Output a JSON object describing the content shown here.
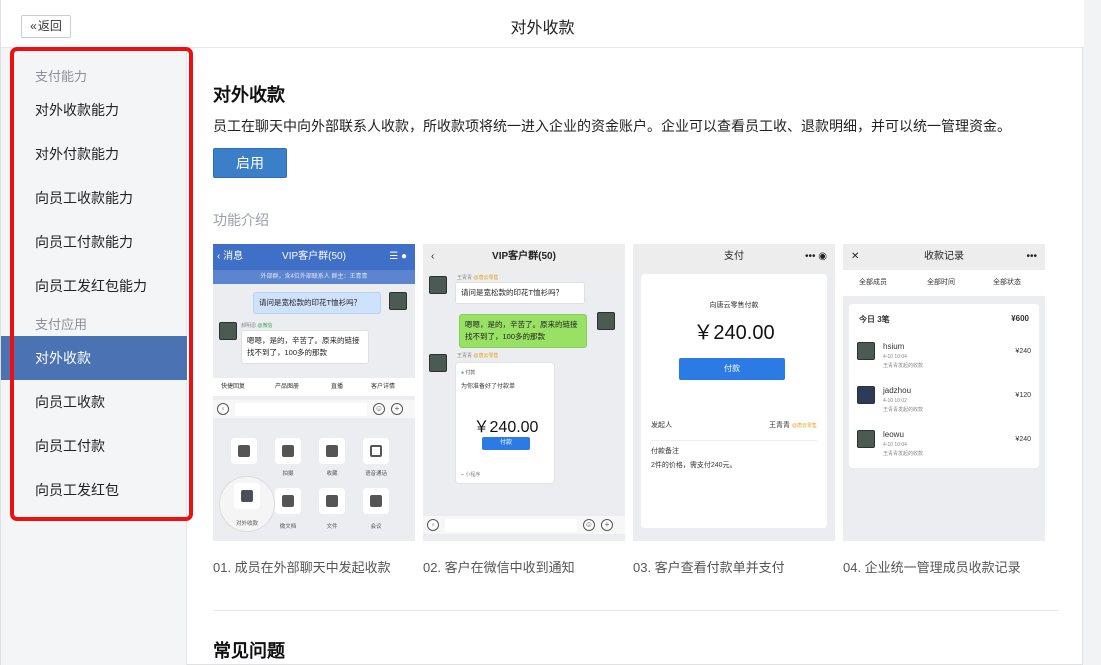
{
  "header": {
    "back_label": "返回",
    "title": "对外收款"
  },
  "sidebar": {
    "section1": "支付能力",
    "items1": [
      "对外收款能力",
      "对外付款能力",
      "向员工收款能力",
      "向员工付款能力",
      "向员工发红包能力"
    ],
    "section2": "支付应用",
    "items2": [
      "对外收款",
      "向员工收款",
      "向员工付款",
      "向员工发红包"
    ],
    "active": "对外收款"
  },
  "main": {
    "title": "对外收款",
    "description": "员工在聊天中向外部联系人收款，所收款项将统一进入企业的资金账户。企业可以查看员工收、退款明细，并可以统一管理资金。",
    "enable_label": "启用",
    "intro_label": "功能介绍",
    "captions": [
      "01. 成员在外部聊天中发起收款",
      "02. 客户在微信中收到通知",
      "03. 客户查看付款单并支付",
      "04. 企业统一管理成员收款记录"
    ],
    "faq_title": "常见问题"
  },
  "shot1": {
    "back": "消息",
    "title": "VIP客户群(50)",
    "subtitle": "外部群，含4位外部联系人 群主：王青青",
    "msg_out": "请问是宽松款的印花T恤衫吗？",
    "sender": "郝明恩",
    "sender_tag": "@微信",
    "msg_in": "嗯嗯，是的，辛苦了。原来的链接找不到了，100多的那款",
    "tools": [
      "快捷回复",
      "产品图册",
      "直播",
      "客户详情"
    ],
    "panel": [
      "拍摄",
      "收藏",
      "语音通话",
      "对外收款",
      "微文档",
      "文件",
      "会议"
    ]
  },
  "shot2": {
    "title": "VIP客户群(50)",
    "sender_name": "王青青",
    "sender_tag": "@唐云零售",
    "msg1": "请问是宽松款的印花T恤衫吗？",
    "msg2": "嗯嗯，是的，辛苦了。原来的链接找不到了，100多的那款",
    "card_source": "付款",
    "card_note": "为你准备好了付款单",
    "amount": "￥240.00",
    "pay_label": "付款",
    "mini_label": "小程序"
  },
  "shot3": {
    "title": "支付",
    "merchant": "向唐云零售付款",
    "amount": "￥240.00",
    "pay_label": "付款",
    "initiator_label": "发起人",
    "initiator": "王青青",
    "initiator_tag": "@唐云零售",
    "note_label": "付款备注",
    "note": "2件的价格，需支付240元。"
  },
  "shot4": {
    "title": "收款记录",
    "filters": [
      "全部成员",
      "全部时间",
      "全部状态"
    ],
    "today_label": "今日 3笔",
    "today_total": "¥600",
    "records": [
      {
        "name": "hsium",
        "time": "4-10 10:04",
        "desc": "王青青发起的收款",
        "amount": "¥240"
      },
      {
        "name": "jadzhou",
        "time": "4-10 10:02",
        "desc": "王青青发起的收款",
        "amount": "¥120"
      },
      {
        "name": "leowu",
        "time": "4-10 10:04",
        "desc": "王青青发起的收款",
        "amount": "¥240"
      }
    ]
  }
}
